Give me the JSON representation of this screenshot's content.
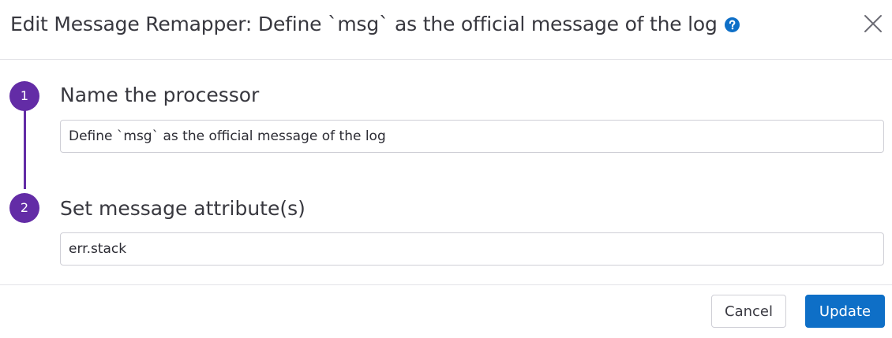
{
  "dialog": {
    "title": "Edit Message Remapper: Define `msg` as the official message of the log",
    "help_icon": "question-circle-icon",
    "close_icon": "close-icon"
  },
  "steps": [
    {
      "number": "1",
      "heading": "Name the processor",
      "input_value": "Define `msg` as the official message of the log"
    },
    {
      "number": "2",
      "heading": "Set message attribute(s)",
      "input_value": "err.stack"
    }
  ],
  "footer": {
    "cancel_label": "Cancel",
    "update_label": "Update"
  },
  "colors": {
    "step_accent": "#632ca6",
    "primary_button": "#0e6fc7",
    "help_icon": "#0e6fc7"
  }
}
